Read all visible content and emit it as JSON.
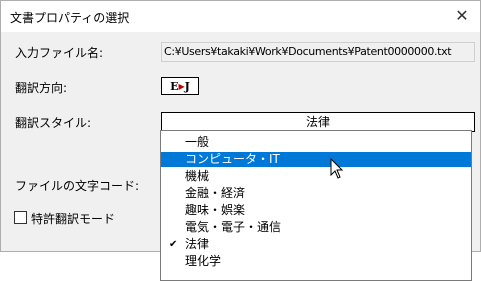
{
  "dialog": {
    "title": "文書プロパティの選択",
    "close_glyph": "✕"
  },
  "fields": {
    "input_file_label": "入力ファイル名:",
    "input_file_value": "C:¥Users¥takaki¥Work¥Documents¥Patent0000000.txt",
    "direction_label": "翻訳方向:",
    "direction_from": "E",
    "direction_to": "J",
    "style_label": "翻訳スタイル:",
    "style_selected": "法律",
    "encoding_label": "ファイルの文字コード:",
    "patent_mode_label": "特許翻訳モード",
    "patent_mode_checked": false
  },
  "dropdown": {
    "options": [
      {
        "label": "一般",
        "highlighted": false,
        "checked": false
      },
      {
        "label": "コンピュータ・IT",
        "highlighted": true,
        "checked": false
      },
      {
        "label": "機械",
        "highlighted": false,
        "checked": false
      },
      {
        "label": "金融・経済",
        "highlighted": false,
        "checked": false
      },
      {
        "label": "趣味・娯楽",
        "highlighted": false,
        "checked": false
      },
      {
        "label": "電気・電子・通信",
        "highlighted": false,
        "checked": false
      },
      {
        "label": "法律",
        "highlighted": false,
        "checked": true
      },
      {
        "label": "理化学",
        "highlighted": false,
        "checked": false
      }
    ],
    "check_glyph": "✔",
    "highlight_color": "#0078d7"
  },
  "icons": {
    "close": "close-icon",
    "direction": "e-to-j-icon",
    "cursor": "mouse-pointer-icon"
  }
}
